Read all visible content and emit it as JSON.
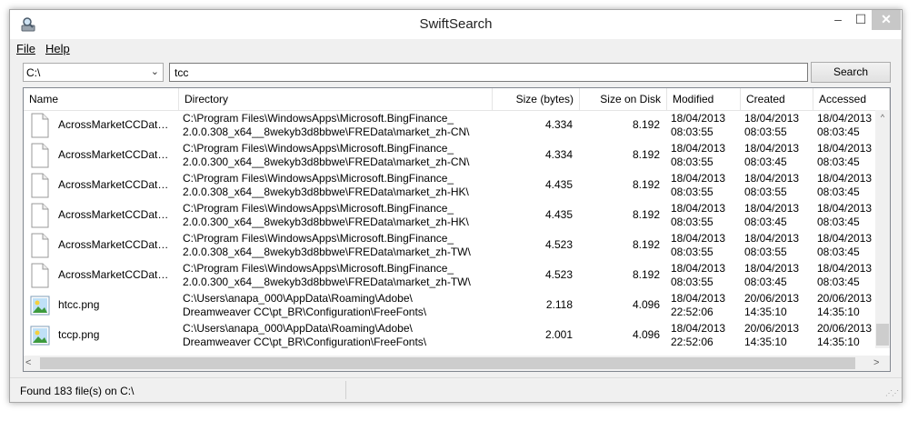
{
  "window": {
    "title": "SwiftSearch",
    "minimize": "–",
    "maximize": "☐",
    "close": "✕"
  },
  "menu": {
    "file": "File",
    "help": "Help"
  },
  "toolbar": {
    "drive": "C:\\",
    "query": "tcc",
    "search_label": "Search"
  },
  "columns": [
    "Name",
    "Directory",
    "Size (bytes)",
    "Size on Disk",
    "Modified",
    "Created",
    "Accessed"
  ],
  "rows": [
    {
      "icon": "document",
      "name": "AcrossMarketCCDataProvider...",
      "dir1": "C:\\Program Files\\WindowsApps\\Microsoft.BingFinance_",
      "dir2": "2.0.0.308_x64__8wekyb3d8bbwe\\FREData\\market_zh-CN\\",
      "size": "4.334",
      "disk": "8.192",
      "mod1": "18/04/2013",
      "mod2": "08:03:55",
      "cre1": "18/04/2013",
      "cre2": "08:03:55",
      "acc1": "18/04/2013",
      "acc2": "08:03:45"
    },
    {
      "icon": "document",
      "name": "AcrossMarketCCDataProvider...",
      "dir1": "C:\\Program Files\\WindowsApps\\Microsoft.BingFinance_",
      "dir2": "2.0.0.300_x64__8wekyb3d8bbwe\\FREData\\market_zh-CN\\",
      "size": "4.334",
      "disk": "8.192",
      "mod1": "18/04/2013",
      "mod2": "08:03:55",
      "cre1": "18/04/2013",
      "cre2": "08:03:45",
      "acc1": "18/04/2013",
      "acc2": "08:03:45"
    },
    {
      "icon": "document",
      "name": "AcrossMarketCCDataProvider...",
      "dir1": "C:\\Program Files\\WindowsApps\\Microsoft.BingFinance_",
      "dir2": "2.0.0.308_x64__8wekyb3d8bbwe\\FREData\\market_zh-HK\\",
      "size": "4.435",
      "disk": "8.192",
      "mod1": "18/04/2013",
      "mod2": "08:03:55",
      "cre1": "18/04/2013",
      "cre2": "08:03:55",
      "acc1": "18/04/2013",
      "acc2": "08:03:45"
    },
    {
      "icon": "document",
      "name": "AcrossMarketCCDataProvider...",
      "dir1": "C:\\Program Files\\WindowsApps\\Microsoft.BingFinance_",
      "dir2": "2.0.0.300_x64__8wekyb3d8bbwe\\FREData\\market_zh-HK\\",
      "size": "4.435",
      "disk": "8.192",
      "mod1": "18/04/2013",
      "mod2": "08:03:55",
      "cre1": "18/04/2013",
      "cre2": "08:03:45",
      "acc1": "18/04/2013",
      "acc2": "08:03:45"
    },
    {
      "icon": "document",
      "name": "AcrossMarketCCDataProvider...",
      "dir1": "C:\\Program Files\\WindowsApps\\Microsoft.BingFinance_",
      "dir2": "2.0.0.308_x64__8wekyb3d8bbwe\\FREData\\market_zh-TW\\",
      "size": "4.523",
      "disk": "8.192",
      "mod1": "18/04/2013",
      "mod2": "08:03:55",
      "cre1": "18/04/2013",
      "cre2": "08:03:55",
      "acc1": "18/04/2013",
      "acc2": "08:03:45"
    },
    {
      "icon": "document",
      "name": "AcrossMarketCCDataProvider...",
      "dir1": "C:\\Program Files\\WindowsApps\\Microsoft.BingFinance_",
      "dir2": "2.0.0.300_x64__8wekyb3d8bbwe\\FREData\\market_zh-TW\\",
      "size": "4.523",
      "disk": "8.192",
      "mod1": "18/04/2013",
      "mod2": "08:03:55",
      "cre1": "18/04/2013",
      "cre2": "08:03:45",
      "acc1": "18/04/2013",
      "acc2": "08:03:45"
    },
    {
      "icon": "image",
      "name": "htcc.png",
      "dir1": "C:\\Users\\anapa_000\\AppData\\Roaming\\Adobe\\",
      "dir2": "Dreamweaver CC\\pt_BR\\Configuration\\FreeFonts\\",
      "size": "2.118",
      "disk": "4.096",
      "mod1": "18/04/2013",
      "mod2": "22:52:06",
      "cre1": "20/06/2013",
      "cre2": "14:35:10",
      "acc1": "20/06/2013",
      "acc2": "14:35:10"
    },
    {
      "icon": "image",
      "name": "tccp.png",
      "dir1": "C:\\Users\\anapa_000\\AppData\\Roaming\\Adobe\\",
      "dir2": "Dreamweaver CC\\pt_BR\\Configuration\\FreeFonts\\",
      "size": "2.001",
      "disk": "4.096",
      "mod1": "18/04/2013",
      "mod2": "22:52:06",
      "cre1": "20/06/2013",
      "cre2": "14:35:10",
      "acc1": "20/06/2013",
      "acc2": "14:35:10"
    }
  ],
  "scroll": {
    "left": "<",
    "right": ">",
    "up": "^"
  },
  "status": {
    "text": "Found 183 file(s) on C:\\"
  }
}
